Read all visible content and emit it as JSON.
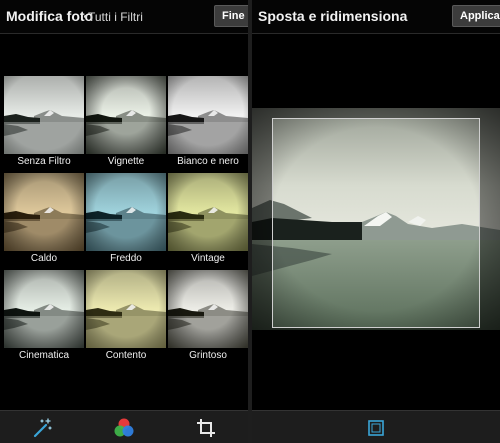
{
  "edit_screen": {
    "title": "Modifica foto",
    "subtitle": "Tutti i Filtri",
    "done_label": "Fine",
    "filters": [
      {
        "label": "Senza Filtro",
        "tint": "#e6eae6",
        "shade": "#1a201c",
        "vignette": 0.15
      },
      {
        "label": "Vignette",
        "tint": "#eaf0e6",
        "shade": "#11160f",
        "vignette": 0.85
      },
      {
        "label": "Bianco e nero",
        "tint": "#f0f0f0",
        "shade": "#151515",
        "vignette": 0.35
      },
      {
        "label": "Caldo",
        "tint": "#ddc79a",
        "shade": "#2a1e0c",
        "vignette": 0.7
      },
      {
        "label": "Freddo",
        "tint": "#9fd2dc",
        "shade": "#0d2228",
        "vignette": 0.55
      },
      {
        "label": "Vintage",
        "tint": "#e2e6a0",
        "shade": "#2a2c10",
        "vignette": 0.6
      },
      {
        "label": "Cinematica",
        "tint": "#e4ece4",
        "shade": "#0e1410",
        "vignette": 0.75
      },
      {
        "label": "Contento",
        "tint": "#ece9b0",
        "shade": "#2e2c12",
        "vignette": 0.45
      },
      {
        "label": "Grintoso",
        "tint": "#ecece6",
        "shade": "#18180f",
        "vignette": 0.8
      }
    ],
    "tools": [
      {
        "icon": "magic-wand-icon"
      },
      {
        "icon": "color-filter-icon"
      },
      {
        "icon": "crop-icon"
      }
    ]
  },
  "crop_screen": {
    "title": "Sposta e ridimensiona",
    "apply_label": "Applica",
    "tool": {
      "icon": "crop-frame-icon",
      "color": "#3aa5d8"
    }
  },
  "colors": {
    "accent": "#3aa5d8"
  }
}
